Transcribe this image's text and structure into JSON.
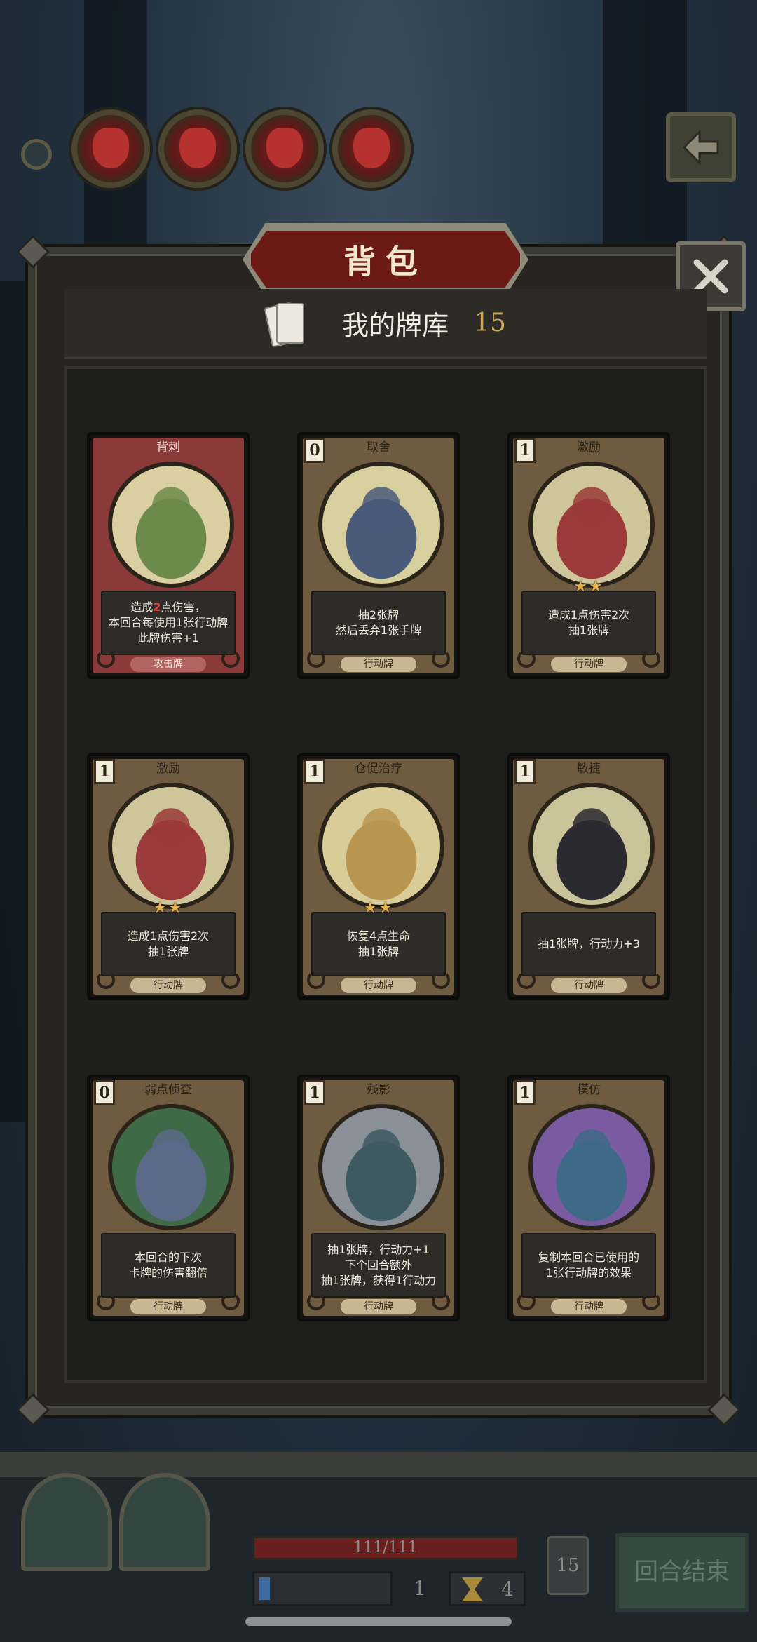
{
  "panel": {
    "title": "背包",
    "deck_label": "我的牌库",
    "deck_count": "15"
  },
  "cards": [
    {
      "name": "背刺",
      "cost": "",
      "desc_parts": [
        "造成",
        "2",
        "点伤害，",
        "本回合每使用1张行动牌",
        "此牌伤害+1"
      ],
      "type": "攻击牌",
      "stars": "",
      "kind": "attack"
    },
    {
      "name": "取舍",
      "cost": "0",
      "desc": "抽2张牌\n然后丢弃1张手牌",
      "type": "行动牌",
      "stars": "",
      "kind": "action"
    },
    {
      "name": "激励",
      "cost": "1",
      "desc": "造成1点伤害2次\n抽1张牌",
      "type": "行动牌",
      "stars": "★★",
      "kind": "action"
    },
    {
      "name": "激励",
      "cost": "1",
      "desc": "造成1点伤害2次\n抽1张牌",
      "type": "行动牌",
      "stars": "★★",
      "kind": "action"
    },
    {
      "name": "仓促治疗",
      "cost": "1",
      "desc": "恢复4点生命\n抽1张牌",
      "type": "行动牌",
      "stars": "★★",
      "kind": "action"
    },
    {
      "name": "敏捷",
      "cost": "1",
      "desc": "抽1张牌，行动力+3",
      "type": "行动牌",
      "stars": "",
      "kind": "action"
    },
    {
      "name": "弱点侦查",
      "cost": "0",
      "desc": "本回合的下次\n卡牌的伤害翻倍",
      "type": "行动牌",
      "stars": "",
      "kind": "action"
    },
    {
      "name": "残影",
      "cost": "1",
      "desc": "抽1张牌，行动力+1\n下个回合额外\n抽1张牌，获得1行动力",
      "type": "行动牌",
      "stars": "",
      "kind": "action"
    },
    {
      "name": "模仿",
      "cost": "1",
      "desc": "复制本回合已使用的\n1张行动牌的效果",
      "type": "行动牌",
      "stars": "",
      "kind": "action"
    }
  ],
  "hud": {
    "hp": "111/111",
    "hp_fraction": 1.0,
    "energy": "1",
    "turns": "4",
    "draw_pile": "15",
    "end_turn_label": "回合结束"
  },
  "icons": {
    "back": "back-arrow-icon",
    "close": "close-icon",
    "deck": "card-stack-icon"
  },
  "colors": {
    "accent_gold": "#c9a55a",
    "title_red": "#6b1a16",
    "damage_red": "#e24038"
  }
}
